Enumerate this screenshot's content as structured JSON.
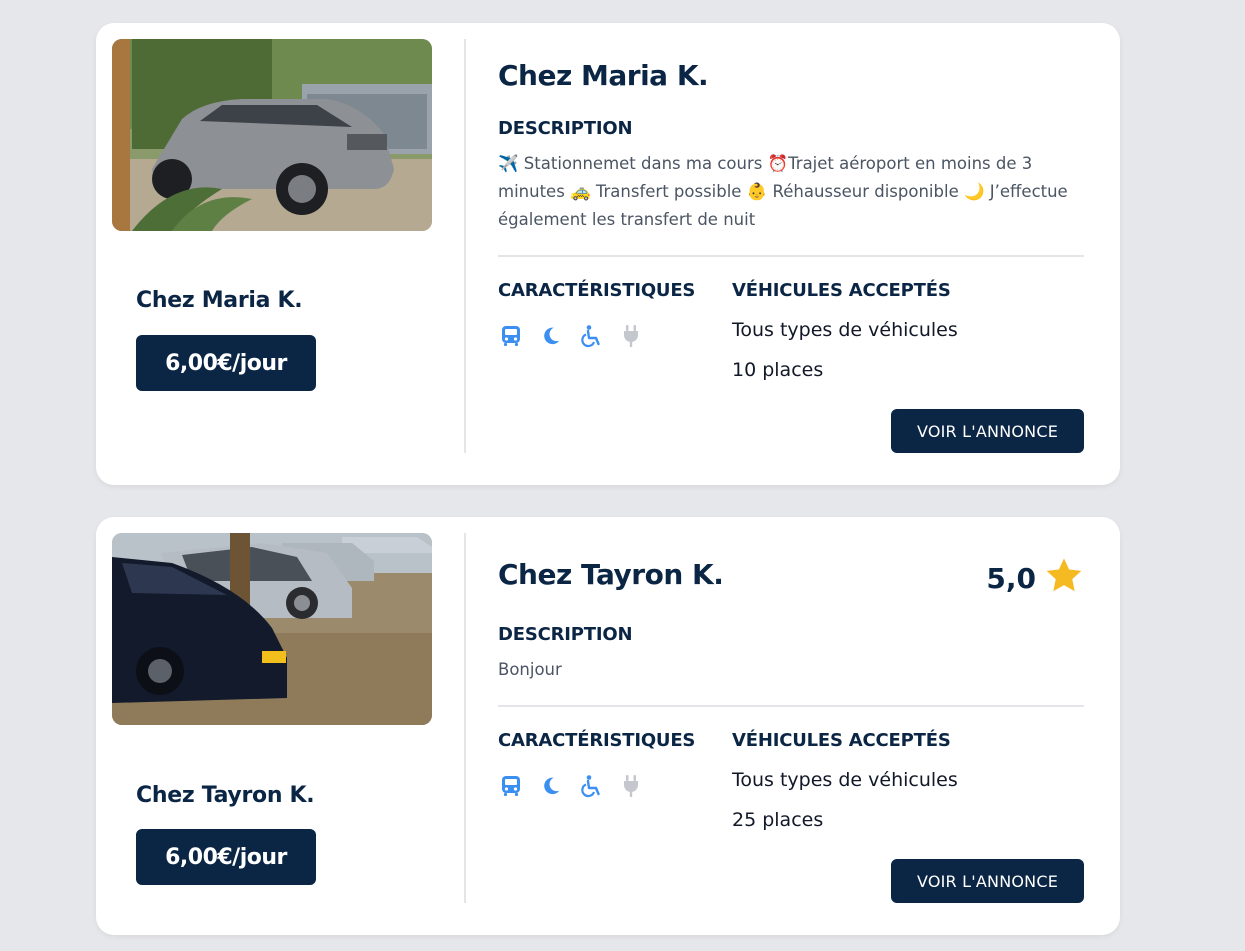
{
  "listings": [
    {
      "name": "Chez Maria K.",
      "price": "6,00€/jour",
      "description_label": "DESCRIPTION",
      "description_parts": {
        "p1": "Stationnemet dans ma cours",
        "p2": "Trajet aéroport en moins de 3 minutes",
        "p3": "Transfert possible",
        "p4": "Réhausseur disponible",
        "p5": "J’effectue également les transfert de nuit"
      },
      "features_label": "CARACTÉRISTIQUES",
      "vehicles_label": "VÉHICULES ACCEPTÉS",
      "vehicle_types": "Tous types de véhicules",
      "places": "10 places",
      "button_label": "VOIR L'ANNONCE",
      "feature_icons": [
        "bus-icon",
        "moon-icon",
        "wheelchair-icon",
        "plug-icon"
      ]
    },
    {
      "name": "Chez Tayron K.",
      "price": "6,00€/jour",
      "rating": "5,0",
      "description_label": "DESCRIPTION",
      "description": "Bonjour",
      "features_label": "CARACTÉRISTIQUES",
      "vehicles_label": "VÉHICULES ACCEPTÉS",
      "vehicle_types": "Tous types de véhicules",
      "places": "25 places",
      "button_label": "VOIR L'ANNONCE",
      "feature_icons": [
        "bus-icon",
        "moon-icon",
        "wheelchair-icon",
        "plug-icon"
      ]
    }
  ],
  "colors": {
    "navy": "#0b2545",
    "accent_blue": "#3b8ff0",
    "disabled_gray": "#c4c8ce",
    "star": "#f5b921",
    "background": "#e6e7ea"
  }
}
